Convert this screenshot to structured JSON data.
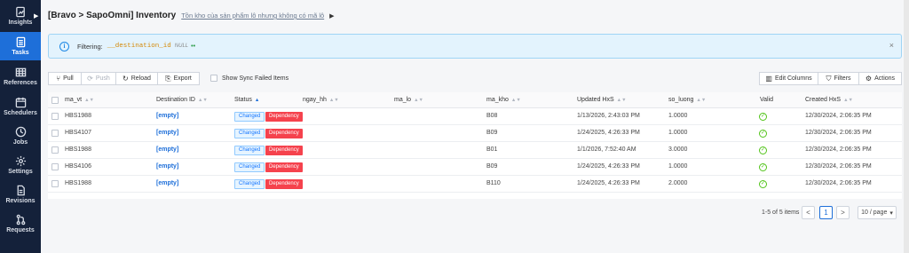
{
  "sidebar": {
    "items": [
      {
        "label": "Insights",
        "icon": "insights-icon"
      },
      {
        "label": "Tasks",
        "icon": "tasks-icon",
        "active": true
      },
      {
        "label": "References",
        "icon": "references-icon"
      },
      {
        "label": "Schedulers",
        "icon": "schedulers-icon"
      },
      {
        "label": "Jobs",
        "icon": "jobs-icon"
      },
      {
        "label": "Settings",
        "icon": "settings-icon"
      },
      {
        "label": "Revisions",
        "icon": "revisions-icon"
      },
      {
        "label": "Requests",
        "icon": "requests-icon"
      }
    ]
  },
  "header": {
    "title": "[Bravo > SapoOmni] Inventory",
    "subtitle": "Tồn kho của sản phẩm lô nhưng không có mã lô",
    "caret": "▶"
  },
  "filter": {
    "label": "Filtering:",
    "field": "__destination_id",
    "null_text": "NULL",
    "dots": "••",
    "close": "×"
  },
  "toolbar": {
    "pull": "Pull",
    "push": "Push",
    "reload": "Reload",
    "export": "Export",
    "sync_failed": "Show Sync Failed Items",
    "edit_columns": "Edit Columns",
    "filters": "Filters",
    "actions": "Actions"
  },
  "table": {
    "columns": {
      "ma_vt": "ma_vt",
      "destination_id": "Destination ID",
      "status": "Status",
      "ngay_hh": "ngay_hh",
      "ma_lo": "ma_lo",
      "ma_kho": "ma_kho",
      "updated": "Updated HxS",
      "so_luong": "so_luong",
      "valid": "Valid",
      "created": "Created HxS"
    },
    "rows": [
      {
        "ma_vt": "HBS1988",
        "destination_id": "[empty]",
        "status": "Changed",
        "tag": "Dependency",
        "ma_kho": "B08",
        "updated": "1/13/2026, 2:43:03 PM",
        "so_luong": "1.0000",
        "created": "12/30/2024, 2:06:35 PM"
      },
      {
        "ma_vt": "HBS4107",
        "destination_id": "[empty]",
        "status": "Changed",
        "tag": "Dependency",
        "ma_kho": "B09",
        "updated": "1/24/2025, 4:26:33 PM",
        "so_luong": "1.0000",
        "created": "12/30/2024, 2:06:35 PM"
      },
      {
        "ma_vt": "HBS1988",
        "destination_id": "[empty]",
        "status": "Changed",
        "tag": "Dependency",
        "ma_kho": "B01",
        "updated": "1/1/2026, 7:52:40 AM",
        "so_luong": "3.0000",
        "created": "12/30/2024, 2:06:35 PM"
      },
      {
        "ma_vt": "HBS4106",
        "destination_id": "[empty]",
        "status": "Changed",
        "tag": "Dependency",
        "ma_kho": "B09",
        "updated": "1/24/2025, 4:26:33 PM",
        "so_luong": "1.0000",
        "created": "12/30/2024, 2:06:35 PM"
      },
      {
        "ma_vt": "HBS1988",
        "destination_id": "[empty]",
        "status": "Changed",
        "tag": "Dependency",
        "ma_kho": "B110",
        "updated": "1/24/2025, 4:26:33 PM",
        "so_luong": "2.0000",
        "created": "12/30/2024, 2:06:35 PM"
      }
    ]
  },
  "pagination": {
    "summary": "1-5 of 5 items",
    "prev": "<",
    "current": "1",
    "next": ">",
    "page_size": "10 / page"
  }
}
